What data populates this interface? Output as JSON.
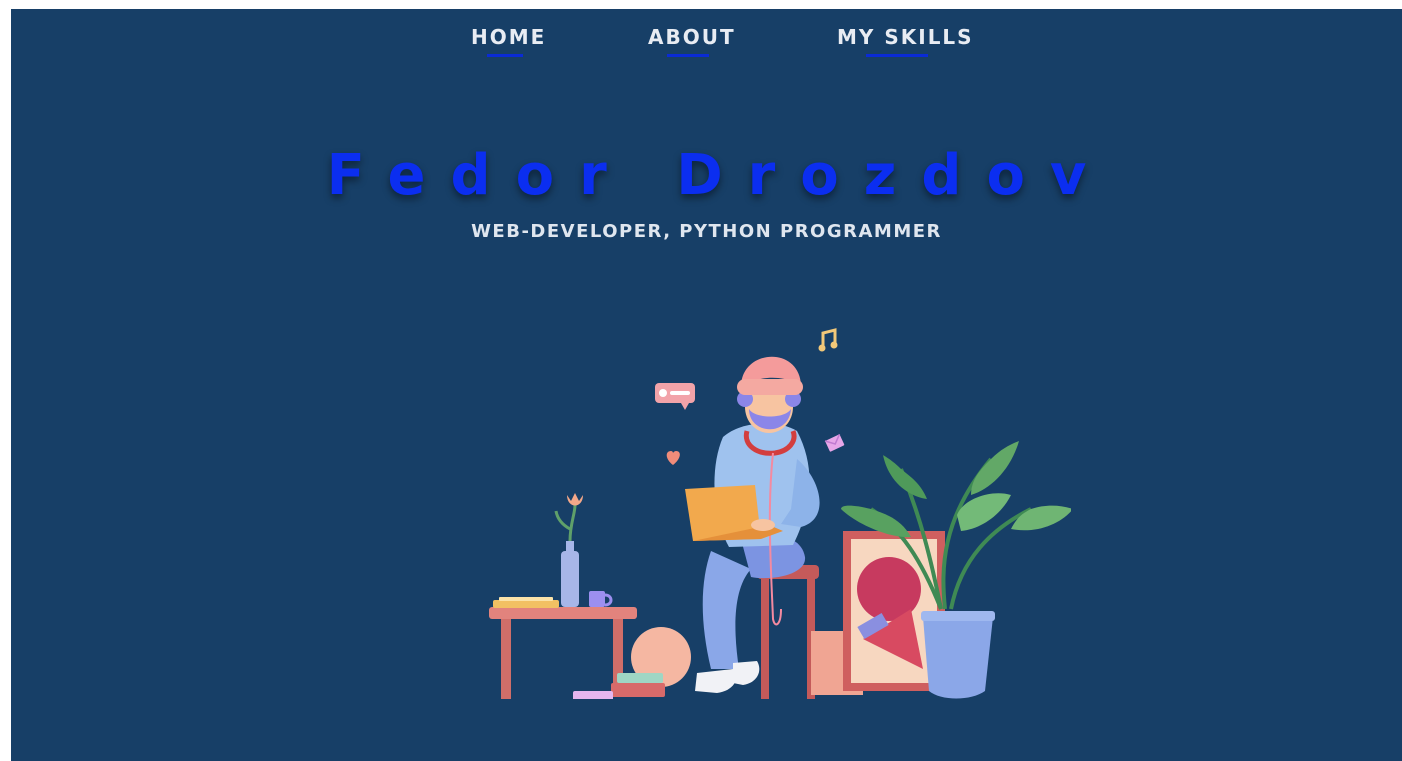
{
  "nav": {
    "items": [
      {
        "label": "HOME"
      },
      {
        "label": "ABOUT"
      },
      {
        "label": "MY SKILLS"
      }
    ]
  },
  "hero": {
    "name": "Fedor Drozdov",
    "subtitle": "WEB-DEVELOPER, PYTHON PROGRAMMER"
  },
  "colors": {
    "background": "#173f67",
    "accent": "#0b2ef0",
    "nav_text": "#e8ecf3"
  },
  "illustration": {
    "icons": [
      "music-note-icon",
      "chat-bubble-icon",
      "heart-icon",
      "envelope-icon"
    ]
  }
}
